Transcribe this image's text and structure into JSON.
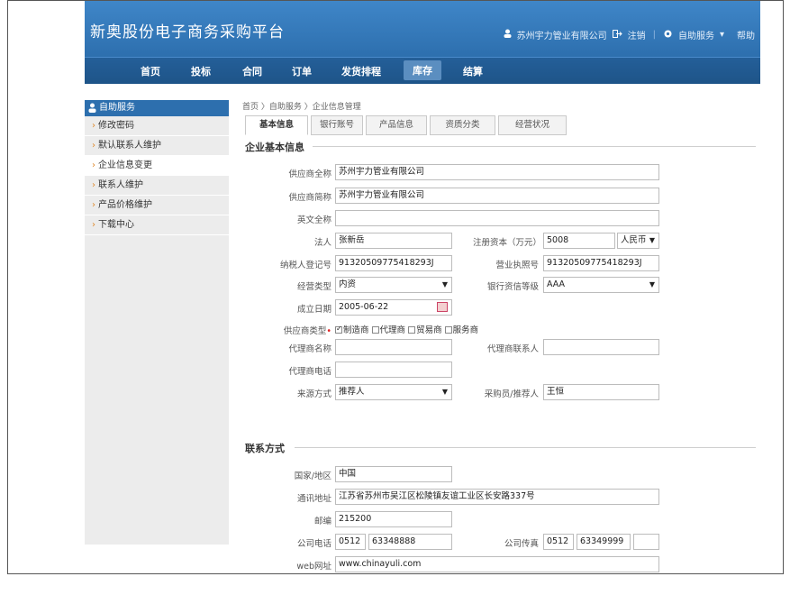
{
  "header": {
    "site_title": "新奥股份电子商务采购平台",
    "company": "苏州宇力管业有限公司",
    "logout": "注销",
    "self_service": "自助服务",
    "help": "帮助"
  },
  "nav": [
    "首页",
    "投标",
    "合同",
    "订单",
    "发货排程",
    "库存",
    "结算"
  ],
  "nav_active": "库存",
  "sidebar": {
    "title": "自助服务",
    "items": [
      "修改密码",
      "默认联系人维护",
      "企业信息变更",
      "联系人维护",
      "产品价格维护",
      "下载中心"
    ],
    "active": "企业信息变更"
  },
  "breadcrumb": "首页 〉自助服务 〉企业信息管理",
  "tabs": [
    "基本信息",
    "银行账号",
    "产品信息",
    "资质分类",
    "经营状况"
  ],
  "basic": {
    "section_title": "企业基本信息",
    "supplier_full_name_label": "供应商全称",
    "supplier_full_name": "苏州宇力管业有限公司",
    "supplier_short_name_label": "供应商简称",
    "supplier_short_name": "苏州宇力管业有限公司",
    "english_name_label": "英文全称",
    "english_name": "",
    "legal_person_label": "法人",
    "legal_person": "张新岳",
    "reg_capital_label": "注册资本（万元）",
    "reg_capital": "5008",
    "currency": "人民币",
    "tax_no_label": "纳税人登记号",
    "tax_no": "91320509775418293J",
    "license_label": "营业执照号",
    "license_no": "91320509775418293J",
    "biz_type_label": "经营类型",
    "biz_type": "内资",
    "credit_label": "银行资信等级",
    "credit": "AAA",
    "founded_label": "成立日期",
    "founded": "2005-06-22",
    "supplier_type_label": "供应商类型",
    "supplier_types": [
      {
        "label": "制造商",
        "checked": true
      },
      {
        "label": "代理商",
        "checked": false
      },
      {
        "label": "贸易商",
        "checked": false
      },
      {
        "label": "服务商",
        "checked": false
      }
    ],
    "agent_name_label": "代理商名称",
    "agent_name": "",
    "agent_contact_label": "代理商联系人",
    "agent_contact": "",
    "agent_phone_label": "代理商电话",
    "agent_phone": "",
    "source_label": "来源方式",
    "source": "推荐人",
    "buyer_label": "采购员/推荐人",
    "buyer": "王恒"
  },
  "contact": {
    "section_title": "联系方式",
    "country_label": "国家/地区",
    "country": "中国",
    "address_label": "通讯地址",
    "address": "江苏省苏州市吴江区松陵镇友谊工业区长安路337号",
    "postcode_label": "邮编",
    "postcode": "215200",
    "phone_label": "公司电话",
    "phone_area": "0512",
    "phone_no": "63348888",
    "fax_label": "公司传真",
    "fax_area": "0512",
    "fax_no": "63349999",
    "fax_ext": "",
    "web_label": "web网址",
    "web": "www.chinayuli.com"
  }
}
